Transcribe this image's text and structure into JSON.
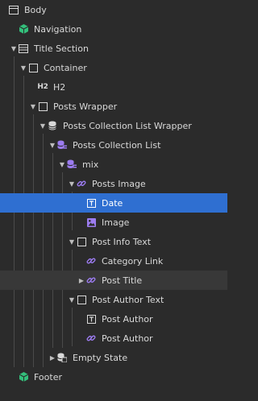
{
  "tree": {
    "items": [
      {
        "label": "Body",
        "icon": "body-icon"
      },
      {
        "label": "Navigation",
        "icon": "component-icon"
      },
      {
        "label": "Title Section",
        "icon": "section-icon"
      },
      {
        "label": "Container",
        "icon": "div-block-icon"
      },
      {
        "label": "H2",
        "icon": "heading-h2-icon"
      },
      {
        "label": "Posts Wrapper",
        "icon": "div-block-icon"
      },
      {
        "label": "Posts Collection List Wrapper",
        "icon": "collection-wrapper-icon"
      },
      {
        "label": "Posts Collection List",
        "icon": "collection-list-icon"
      },
      {
        "label": "mix",
        "icon": "collection-list-icon"
      },
      {
        "label": "Posts Image",
        "icon": "link-icon"
      },
      {
        "label": "Date",
        "icon": "text-field-icon"
      },
      {
        "label": "Image",
        "icon": "image-icon"
      },
      {
        "label": "Post Info Text",
        "icon": "div-block-icon"
      },
      {
        "label": "Category Link",
        "icon": "link-icon"
      },
      {
        "label": "Post Title",
        "icon": "link-icon"
      },
      {
        "label": "Post Author Text",
        "icon": "div-block-icon"
      },
      {
        "label": "Post Author",
        "icon": "text-field-icon"
      },
      {
        "label": "Post Author",
        "icon": "link-icon"
      },
      {
        "label": "Empty State",
        "icon": "empty-state-icon"
      },
      {
        "label": "Footer",
        "icon": "component-icon"
      }
    ],
    "selected_index": 10,
    "hover_index": 14,
    "colors": {
      "background": "#2b2b2b",
      "selected": "#2f6fd1",
      "hover": "#383838",
      "component": "#33c07b",
      "cms": "#9c7cf0"
    }
  }
}
